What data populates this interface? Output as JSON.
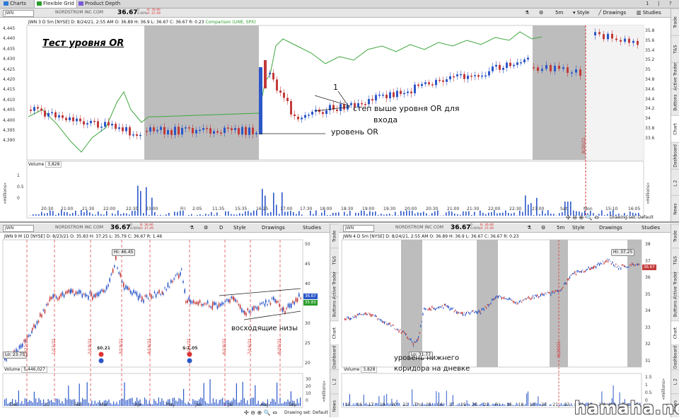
{
  "tabs": [
    {
      "label": "Charts"
    },
    {
      "label": "Flexible Grid"
    },
    {
      "label": "Product Depth"
    }
  ],
  "window_controls": [
    "1",
    "|",
    "?"
  ],
  "top": {
    "symbol": "JWN",
    "company": "NORDSTROM INC COM",
    "price": "36.67",
    "change": "0",
    "change_pct": "0.00%",
    "bid": "B: 36.66",
    "ask": "A: 37.49",
    "interval": "5m",
    "style": "Style",
    "drawings": "Drawings",
    "studies": "Studies",
    "info": "JWN 3 D 5m [NYSE]  D: 8/24/21, 2:55 AM  O: 36.89  H: 36.9  L: 36.67  C: 36.67  R: 0.23",
    "comparison": "Comparison (LINE, SPX)",
    "title": "Тест уровня OR",
    "annot1": "1",
    "annot2": "степ выше уровня OR для",
    "annot3": "входа",
    "annot4": "уровень OR",
    "yl": [
      "4,445",
      "4,440",
      "4,435",
      "4,430",
      "4,425",
      "4,420",
      "4,415",
      "4,410",
      "4,405",
      "4,400",
      "4,395",
      "4,390"
    ],
    "yr": [
      "35.8",
      "35.6",
      "35.4",
      "35.2",
      "35",
      "34.8",
      "34.6",
      "34.4",
      "34.2",
      "34",
      "33.8",
      "33.6"
    ],
    "vol_label": "Volume",
    "vol_value": "3,828",
    "vol_unit": "«millions»",
    "vol_y": [
      "1",
      "0.5",
      "0"
    ],
    "date_marker": "8/20/21",
    "x": [
      "20:30",
      "21:00",
      "21:30",
      "22:00",
      "22:30",
      "23:00",
      "Fri",
      "2:05",
      "11:35",
      "15:35",
      "16:25",
      "17:00",
      "17:30",
      "18:00",
      "18:30",
      "19:00",
      "19:30",
      "20:00",
      "20:30",
      "21:00",
      "21:30",
      "22:00",
      "22:30",
      "23:00",
      "Sat",
      "Mon",
      "15:10",
      "16:05"
    ],
    "status": "Drawing set: Default"
  },
  "bl": {
    "symbol": "JWN",
    "company": "NORDSTROM INC COM",
    "price": "36.67",
    "change": "0",
    "change_pct": "0.00%",
    "bid": "B: 36.66",
    "ask": "A: 37.49",
    "interval": "D",
    "style": "Style",
    "drawings": "Drawings",
    "studies": "Studies",
    "info": "JWN 9 M 1D [NYSE]  D: 8/23/21  O: 35.83  H: 37.25  L: 35.79  C: 36.67  R: 1.46",
    "hi": "Hi: 46.45",
    "lo": "Lo: 23.75",
    "annot": "восходящие низы",
    "div1": "$0.21",
    "div2": "$-1.05",
    "yr": [
      "50",
      "45",
      "40",
      "35",
      "30",
      "25",
      "20"
    ],
    "price_tag": "36.67",
    "price_tag2": "35.83",
    "vol_label": "Volume",
    "vol_value": "5,446,027",
    "vol_unit": "«millions»",
    "vol_y": [
      "30",
      "20",
      "10",
      "0"
    ],
    "dates": [
      "12/22/20",
      "1/15/21",
      "2/19/21",
      "3/19/21",
      "4/16/21",
      "5/21/21",
      "6/18/21",
      "7/16/21",
      "8/20/21"
    ],
    "x": [
      "Dec",
      "21",
      "Feb",
      "Mar",
      "Apr",
      "May",
      "Jun",
      "Jul",
      "Aug",
      "Sep"
    ],
    "status": "Drawing set: Default"
  },
  "br": {
    "symbol": "JWN",
    "company": "NORDSTROM INC COM",
    "price": "36.67",
    "change": "0",
    "change_pct": "0.00%",
    "bid": "B: 36.66",
    "ask": "A: 37.49",
    "interval": "5m",
    "style": "Style",
    "drawings": "Drawings",
    "studies": "Studies",
    "info": "JWN 4 D 5m [NYSE]  D: 8/24/21, 2:55 AM  O: 36.89  H: 36.9  L: 36.67  C: 36.67  R: 0.23",
    "hi": "Hi: 37.25",
    "lo": "Lo: 31.77",
    "annot1": "уровень нижнего",
    "annot2": "коридора на дневке",
    "yr": [
      "38",
      "37",
      "36",
      "35",
      "34",
      "33",
      "32",
      "31"
    ],
    "price_tag": "36.67",
    "date_marker": "8/20/21",
    "vol_label": "Volume",
    "vol_value": "3,828",
    "vol_unit": "«millions»",
    "vol_y": [
      "1.5",
      "1",
      "0.5",
      "0"
    ],
    "x": [
      "15",
      "16",
      "17",
      "19",
      "20",
      "21",
      "Thu",
      "15",
      "16",
      "17",
      "19",
      "20",
      "21",
      "Fri",
      "16",
      "18",
      "19",
      "20",
      "21",
      "23",
      "Sat",
      "16",
      "18",
      "19",
      "Tue",
      "16"
    ]
  },
  "side_top": [
    "Trade",
    "T&S",
    "Active Trader",
    "Buttons",
    "Chart",
    "Dashboard",
    "L 2",
    "News"
  ],
  "side_mid": [
    "Trade",
    "T&S",
    "Active Trader",
    "Buttons",
    "Chart",
    "Dashboard",
    "L 2",
    "News"
  ],
  "side_right": [
    "Trade",
    "T&S",
    "Active Trader",
    "Buttons",
    "Chart",
    "Dashboard",
    "L 2",
    "News"
  ],
  "watermark": "hamaha.net",
  "colors": {
    "up": "#2b57c9",
    "down": "#c43a3a",
    "compare": "#3fa83f",
    "shade": "#bdbdbd"
  }
}
